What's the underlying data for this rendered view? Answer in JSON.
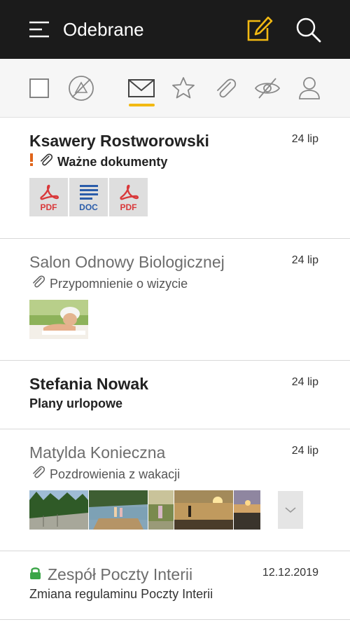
{
  "header": {
    "title": "Odebrane",
    "icons": {
      "menu": "hamburger-icon",
      "compose": "compose-icon",
      "search": "search-icon"
    },
    "accent_color": "#f2b912",
    "background": "#1b1b1b"
  },
  "filters": {
    "items": [
      "checkbox",
      "unread-off-icon",
      "mail-icon",
      "star-icon",
      "attachment-icon",
      "hidden-icon",
      "person-icon"
    ],
    "active": "mail-icon"
  },
  "messages": [
    {
      "sender": "Ksawery Rostworowski",
      "date": "24 lip",
      "subject": "Ważne dokumenty",
      "unread": true,
      "important": true,
      "has_attachment": true,
      "attachments": [
        {
          "type": "PDF",
          "label": "PDF",
          "color": "#d9383a"
        },
        {
          "type": "DOC",
          "label": "DOC",
          "color": "#2a5caa"
        },
        {
          "type": "PDF",
          "label": "PDF",
          "color": "#d9383a"
        }
      ]
    },
    {
      "sender": "Salon Odnowy Biologicznej",
      "date": "24 lip",
      "subject": "Przypomnienie o wizycie",
      "unread": false,
      "has_attachment": true,
      "photo_count": 1
    },
    {
      "sender": "Stefania Nowak",
      "date": "24 lip",
      "subject": "Plany urlopowe",
      "unread": true,
      "has_attachment": false
    },
    {
      "sender": "Matylda Konieczna",
      "date": "24 lip",
      "subject": "Pozdrowienia z wakacji",
      "unread": false,
      "has_attachment": true,
      "photo_count": 6
    },
    {
      "sender": "Zespół Poczty Interii",
      "date": "12.12.2019",
      "subject": "Zmiana regulaminu Poczty Interii",
      "unread": false,
      "verified": true,
      "verified_color": "#3aa547"
    }
  ]
}
